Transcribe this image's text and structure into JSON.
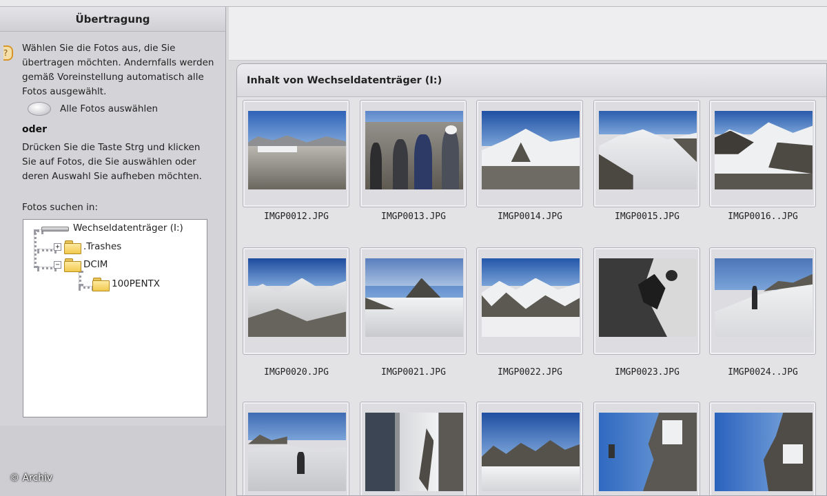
{
  "sidebar": {
    "title": "Übertragung",
    "instruction": "Wählen Sie die Fotos aus, die Sie übertragen möchten. Andernfalls werden gemäß Voreinstellung automatisch alle Fotos ausgewählt.",
    "select_all_label": "Alle Fotos auswählen",
    "or_label": "oder",
    "ctrl_instruction": "Drücken Sie die Taste Strg und klicken Sie auf Fotos, die Sie auswählen oder deren Auswahl Sie aufheben möchten.",
    "search_in_label": "Fotos suchen in:",
    "tree": {
      "drive": "Wechseldatenträger (I:)",
      "folders": [
        ".Trashes",
        "DCIM"
      ],
      "subfolder": "100PENTX"
    }
  },
  "content": {
    "header": "Inhalt von Wechseldatenträger (I:)",
    "photos": [
      {
        "name": "IMGP0012.JPG",
        "scene": "ridge-blue"
      },
      {
        "name": "IMGP0013.JPG",
        "scene": "people"
      },
      {
        "name": "IMGP0014.JPG",
        "scene": "snowpeak"
      },
      {
        "name": "IMGP0015.JPG",
        "scene": "glacier"
      },
      {
        "name": "IMGP0016..JPG",
        "scene": "glacier2"
      },
      {
        "name": "IMGP0020.JPG",
        "scene": "glacier3"
      },
      {
        "name": "IMGP0021.JPG",
        "scene": "peak-cloud"
      },
      {
        "name": "IMGP0022.JPG",
        "scene": "glacier4"
      },
      {
        "name": "IMGP0023.JPG",
        "scene": "climber-bw"
      },
      {
        "name": "IMGP0024..JPG",
        "scene": "slope-hiker"
      },
      {
        "name": "",
        "scene": "slope-hiker2"
      },
      {
        "name": "",
        "scene": "icewall"
      },
      {
        "name": "",
        "scene": "ridge-sky"
      },
      {
        "name": "",
        "scene": "rotated-rock"
      },
      {
        "name": "",
        "scene": "rotated-rock2"
      }
    ]
  },
  "watermark": "© Archiv",
  "colors": {
    "sky": "#2f63b8",
    "snow": "#eef0f2",
    "rock": "#4e4c48",
    "panel": "#e3e3e6"
  }
}
